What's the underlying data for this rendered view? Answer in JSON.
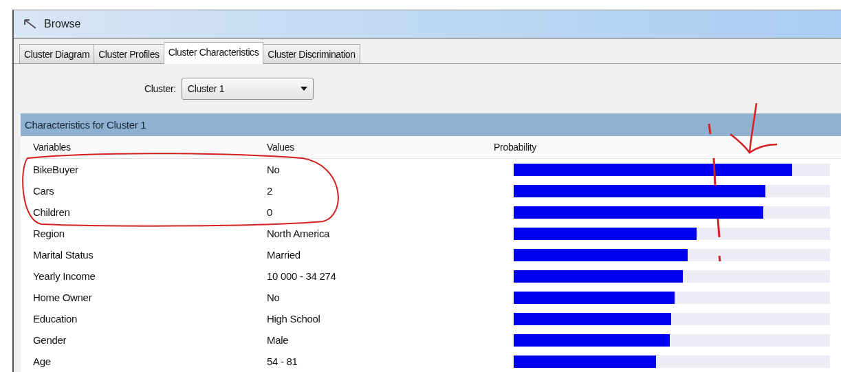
{
  "window": {
    "title": "Browse"
  },
  "tabs": [
    {
      "label": "Cluster Diagram",
      "selected": false
    },
    {
      "label": "Cluster Profiles",
      "selected": false
    },
    {
      "label": "Cluster Characteristics",
      "selected": true
    },
    {
      "label": "Cluster Discrimination",
      "selected": false
    }
  ],
  "cluster_picker": {
    "label": "Cluster:",
    "value": "Cluster 1"
  },
  "panel": {
    "title": "Characteristics for Cluster 1"
  },
  "table": {
    "columns": [
      "Variables",
      "Values",
      "Probability"
    ],
    "rows": [
      {
        "variable": "BikeBuyer",
        "value": "No",
        "level": 0.88
      },
      {
        "variable": "Cars",
        "value": "2",
        "level": 0.795
      },
      {
        "variable": "Children",
        "value": "0",
        "level": 0.79
      },
      {
        "variable": "Region",
        "value": "North America",
        "level": 0.578
      },
      {
        "variable": "Marital Status",
        "value": "Married",
        "level": 0.55
      },
      {
        "variable": "Yearly Income",
        "value": "10 000 - 34 274",
        "level": 0.535
      },
      {
        "variable": "Home Owner",
        "value": "No",
        "level": 0.509
      },
      {
        "variable": "Education",
        "value": "High School",
        "level": 0.498
      },
      {
        "variable": "Gender",
        "value": "Male",
        "level": 0.494
      },
      {
        "variable": "Age",
        "value": "54 - 81",
        "level": 0.45
      }
    ]
  }
}
